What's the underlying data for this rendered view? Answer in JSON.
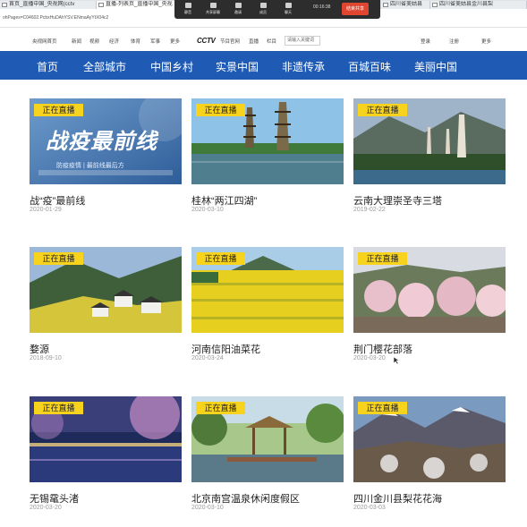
{
  "browser": {
    "tabs": [
      {
        "label": "首页_直播中国_央视网(cctv"
      },
      {
        "label": "直播-列表页_直播中国_央视"
      },
      {
        "label": "四川省美姑县"
      },
      {
        "label": "四川省美姑县金川县梨"
      }
    ],
    "address": "ohPages=C04602.PcbxHuDAhYSV.ENmaAyYtX04c2"
  },
  "meeting_toolbar": {
    "items": [
      {
        "label": "静音"
      },
      {
        "label": "共享屏幕"
      },
      {
        "label": "邀请"
      },
      {
        "label": "成员"
      },
      {
        "label": "聊天"
      }
    ],
    "time": "00:16:38",
    "stop_label": "结束共享"
  },
  "site": {
    "top_links": [
      "央视网首页",
      "新闻",
      "视频",
      "经济",
      "体育",
      "军事",
      "更多"
    ],
    "brand": "CCTV",
    "brand_sub": "节目官网",
    "mid_links": [
      "直播",
      "栏目"
    ],
    "search_placeholder": "请输入关键词",
    "right_links": [
      "登录",
      "注册",
      "更多"
    ],
    "main_nav": [
      "首页",
      "全部城市",
      "中国乡村",
      "实景中国",
      "非遗传承",
      "百城百味",
      "美丽中国"
    ]
  },
  "live_badge": "正在直播",
  "cards": [
    {
      "title": "战“疫”最前线",
      "date": "2020-01-29",
      "poster_text": "战疫最前线",
      "poster_sub": "防疫疫情 | 最前线最后方"
    },
    {
      "title": "桂林“两江四湖”",
      "date": "2020-03-10"
    },
    {
      "title": "云南大理崇圣寺三塔",
      "date": "2019-02-22"
    },
    {
      "title": "婺源",
      "date": "2018-09-10"
    },
    {
      "title": "河南信阳油菜花",
      "date": "2020-03-24"
    },
    {
      "title": "荆门樱花部落",
      "date": "2020-03-20"
    },
    {
      "title": "无锡鼋头渚",
      "date": "2020-03-20"
    },
    {
      "title": "北京南宫温泉休闲度假区",
      "date": "2020-03-10"
    },
    {
      "title": "四川金川县梨花花海",
      "date": "2020-03-03"
    }
  ],
  "colors": {
    "nav_blue": "#1f5bb4",
    "badge_yellow": "#f7d31d",
    "stop_red": "#e0462f"
  }
}
